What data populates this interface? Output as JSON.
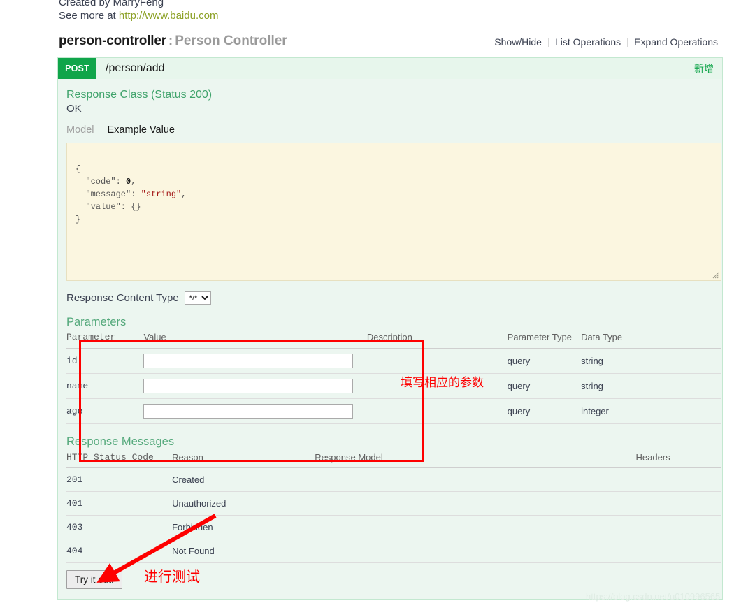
{
  "info": {
    "created_by": "Created by MarryFeng",
    "see_more_prefix": "See more at ",
    "see_more_link": "http://www.baidu.com"
  },
  "resource": {
    "name": "person-controller",
    "separator": ":",
    "description": "Person Controller",
    "options": {
      "show_hide": "Show/Hide",
      "list_operations": "List Operations",
      "expand_operations": "Expand Operations"
    }
  },
  "operation": {
    "method": "POST",
    "path": "/person/add",
    "summary": "新增",
    "response_class": {
      "title": "Response Class (Status 200)",
      "status_text": "OK",
      "tabs": {
        "model": "Model",
        "example_value": "Example Value"
      },
      "example_json": "{\n  \"code\": 0,\n  \"message\": \"string\",\n  \"value\": {}\n}"
    },
    "content_type": {
      "label": "Response Content Type",
      "selected": "*/*",
      "options": [
        "*/*"
      ]
    },
    "parameters": {
      "title": "Parameters",
      "headers": {
        "parameter": "Parameter",
        "value": "Value",
        "description": "Description",
        "parameter_type": "Parameter Type",
        "data_type": "Data Type"
      },
      "rows": [
        {
          "name": "id",
          "value": "",
          "placeholder": "",
          "description": "",
          "param_type": "query",
          "data_type": "string"
        },
        {
          "name": "name",
          "value": "",
          "placeholder": "",
          "description": "",
          "param_type": "query",
          "data_type": "string"
        },
        {
          "name": "age",
          "value": "",
          "placeholder": "",
          "description": "",
          "param_type": "query",
          "data_type": "integer"
        }
      ]
    },
    "response_messages": {
      "title": "Response Messages",
      "headers": {
        "status_code": "HTTP Status Code",
        "reason": "Reason",
        "response_model": "Response Model",
        "headers": "Headers"
      },
      "rows": [
        {
          "code": "201",
          "reason": "Created",
          "model": "",
          "headers": ""
        },
        {
          "code": "401",
          "reason": "Unauthorized",
          "model": "",
          "headers": ""
        },
        {
          "code": "403",
          "reason": "Forbidden",
          "model": "",
          "headers": ""
        },
        {
          "code": "404",
          "reason": "Not Found",
          "model": "",
          "headers": ""
        }
      ]
    },
    "try_button": "Try it out!"
  },
  "annotations": {
    "fill_parameters": "填写相应的参数",
    "run_test": "进行测试"
  },
  "watermark": "https://blog.csdn.net/u010996565",
  "colors": {
    "post_green": "#10a54a",
    "panel_bg": "#ecf6f0",
    "panel_border": "#c3e8d0",
    "section_green": "#55a97c",
    "link_olive": "#8ba024",
    "annotation_red": "#fe0000",
    "code_bg": "#fbf6e0"
  }
}
